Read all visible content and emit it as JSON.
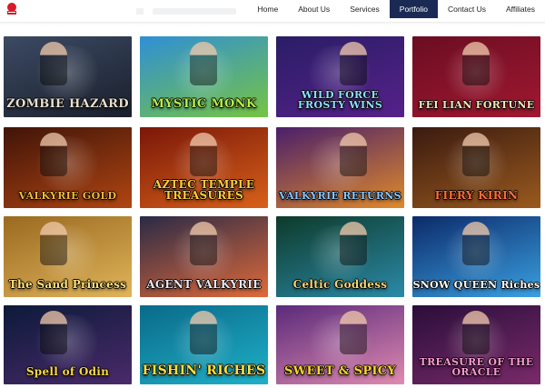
{
  "header": {
    "logo_icon": "brand-logo-icon",
    "nav": [
      {
        "label": "Home",
        "active": false
      },
      {
        "label": "About Us",
        "active": false
      },
      {
        "label": "Services",
        "active": false
      },
      {
        "label": "Portfolio",
        "active": true
      },
      {
        "label": "Contact Us",
        "active": false
      },
      {
        "label": "Affiliates",
        "active": false
      }
    ],
    "accent_color": "#1b2a55"
  },
  "games": [
    {
      "title": "ZOMBIE HAZARD",
      "bg": [
        "#3b4a63",
        "#1a1f2c"
      ],
      "title_color": "#e8e0d0"
    },
    {
      "title": "MYSTIC MONK",
      "bg": [
        "#2f8fd6",
        "#76c442"
      ],
      "title_color": "#b7f04a"
    },
    {
      "title": "WILD FORCE FROSTY WINS",
      "bg": [
        "#2a1d66",
        "#56218a"
      ],
      "title_color": "#8fe0ff"
    },
    {
      "title": "FEI LIAN FORTUNE",
      "bg": [
        "#6b0d22",
        "#a01830"
      ],
      "title_color": "#f6e7b8"
    },
    {
      "title": "VALKYRIE GOLD",
      "bg": [
        "#401408",
        "#b04512"
      ],
      "title_color": "#f5b93a"
    },
    {
      "title": "AZTEC TEMPLE TREASURES",
      "bg": [
        "#7a1708",
        "#d8611a"
      ],
      "title_color": "#ffce3c"
    },
    {
      "title": "VALKYRIE RETURNS",
      "bg": [
        "#4a1f6a",
        "#e08a2a"
      ],
      "title_color": "#8ac6ff"
    },
    {
      "title": "FIERY KIRIN",
      "bg": [
        "#3a1a10",
        "#9a5a1e"
      ],
      "title_color": "#ff6d3a"
    },
    {
      "title": "The Sand Princess",
      "bg": [
        "#9a6a20",
        "#e0b45a"
      ],
      "title_color": "#ffe27a"
    },
    {
      "title": "AGENT VALKYRIE",
      "bg": [
        "#2a2a46",
        "#e06a3a"
      ],
      "title_color": "#e8e8f0"
    },
    {
      "title": "Celtic Goddess",
      "bg": [
        "#0e3a2a",
        "#2a8aa8"
      ],
      "title_color": "#f3d67a"
    },
    {
      "title": "SNOW QUEEN Riches",
      "bg": [
        "#0c2a6a",
        "#3aa0e0"
      ],
      "title_color": "#ffffff"
    },
    {
      "title": "Spell of Odin",
      "bg": [
        "#0c1a3a",
        "#4a2a6a"
      ],
      "title_color": "#ffd84a"
    },
    {
      "title": "FISHIN' RICHES",
      "bg": [
        "#0a6a8a",
        "#1fb0c8"
      ],
      "title_color": "#ffe03a"
    },
    {
      "title": "SWEET & SPICY",
      "bg": [
        "#5a2a7a",
        "#e08ab0"
      ],
      "title_color": "#ffd62a"
    },
    {
      "title": "TREASURE OF THE ORACLE",
      "bg": [
        "#2a0e3a",
        "#7a2a6a"
      ],
      "title_color": "#ff9ad8"
    }
  ]
}
